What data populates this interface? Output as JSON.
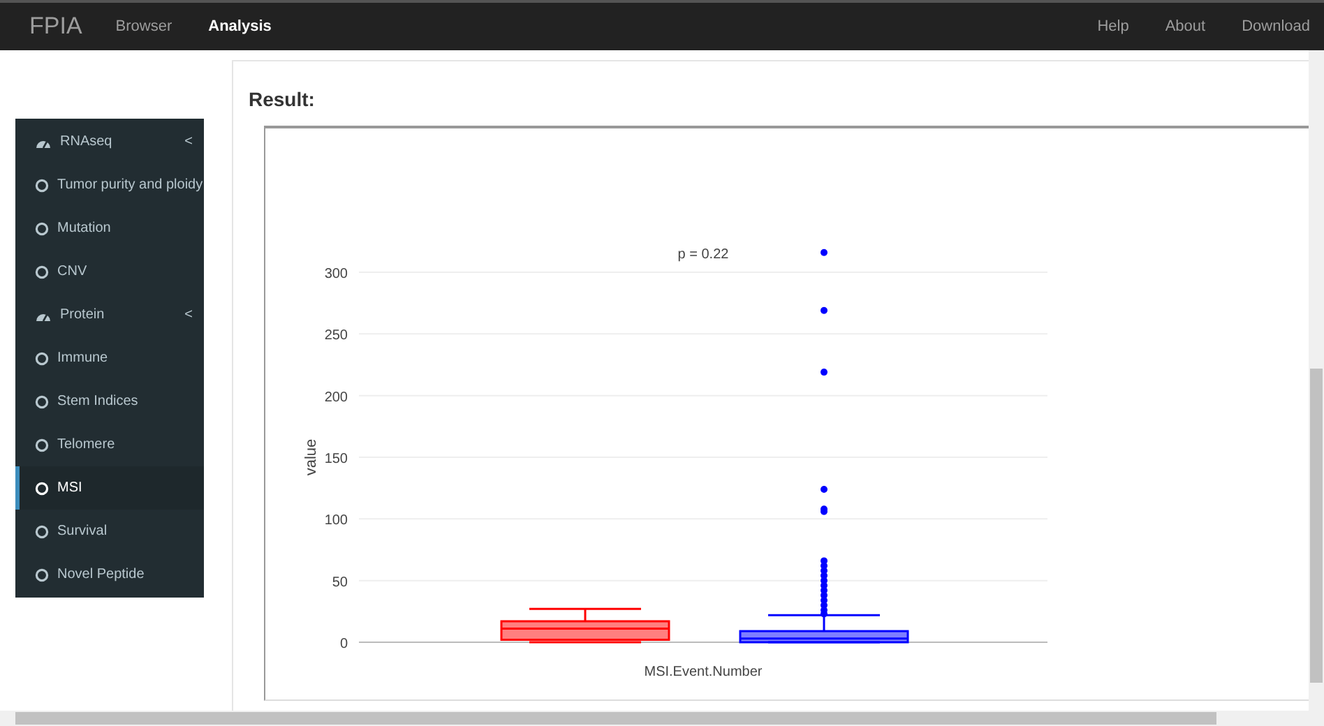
{
  "navbar": {
    "brand": "FPIA",
    "links": [
      {
        "label": "Browser",
        "selected": false
      },
      {
        "label": "Analysis",
        "selected": true
      }
    ],
    "right_links": [
      "Help",
      "About",
      "Download"
    ]
  },
  "sidebar": {
    "items": [
      {
        "kind": "group",
        "label": "RNAseq",
        "selected": false,
        "toggle": "<"
      },
      {
        "kind": "item",
        "label": "Tumor purity and ploidy",
        "selected": false
      },
      {
        "kind": "item",
        "label": "Mutation",
        "selected": false
      },
      {
        "kind": "item",
        "label": "CNV",
        "selected": false
      },
      {
        "kind": "group",
        "label": "Protein",
        "selected": false,
        "toggle": "<"
      },
      {
        "kind": "item",
        "label": "Immune",
        "selected": false
      },
      {
        "kind": "item",
        "label": "Stem Indices",
        "selected": false
      },
      {
        "kind": "item",
        "label": "Telomere",
        "selected": false
      },
      {
        "kind": "item",
        "label": "MSI",
        "selected": true
      },
      {
        "kind": "item",
        "label": "Survival",
        "selected": false
      },
      {
        "kind": "item",
        "label": "Novel Peptide",
        "selected": false
      }
    ]
  },
  "result": {
    "title": "Result:",
    "plot": {
      "ylabel": "value",
      "xlabel": "MSI.Event.Number",
      "annotation": "p = 0.22",
      "yticks": [
        "300",
        "250",
        "200",
        "150",
        "100",
        "50",
        "0"
      ]
    }
  }
}
